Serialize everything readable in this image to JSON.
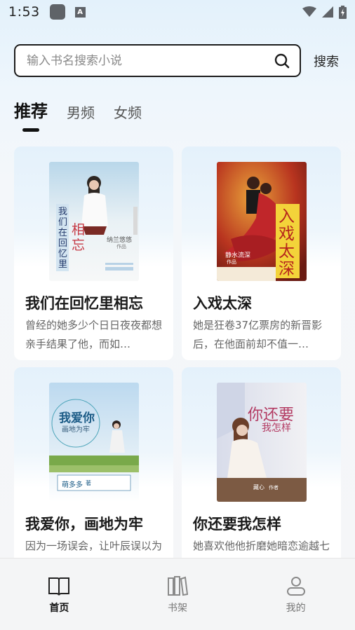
{
  "status_bar": {
    "time": "1:53",
    "icons": [
      "app-square-icon",
      "a-badge-icon",
      "wifi-icon",
      "signal-icon",
      "battery-icon"
    ]
  },
  "search": {
    "placeholder": "输入书名搜索小说",
    "button_label": "搜索"
  },
  "tabs": [
    {
      "label": "推荐",
      "active": true
    },
    {
      "label": "男频",
      "active": false
    },
    {
      "label": "女频",
      "active": false
    }
  ],
  "books": [
    {
      "title": "我们在回忆里相忘",
      "description": "曾经的她多少个日日夜夜都想亲手结果了他，而如…",
      "cover": {
        "title_a": "我们在回忆里",
        "title_b": "相忘",
        "author": "纳兰悠悠",
        "tag": "作品"
      }
    },
    {
      "title": "入戏太深",
      "description": "她是狂卷37亿票房的新晋影后，在他面前却不值一…",
      "cover": {
        "title": "入戏太深",
        "author": "静水流深",
        "tag": "作品"
      }
    },
    {
      "title": "我爱你，画地为牢",
      "description": "因为一场误会，让叶辰误以为她想谋害叶家，自此…",
      "cover": {
        "title": "我爱你",
        "subtitle": "画地为牢",
        "author": "萌多多",
        "tag": "著"
      }
    },
    {
      "title": "你还要我怎样",
      "description": "她喜欢他他折磨她暗恋逾越七年，受尽屈辱不死不…",
      "cover": {
        "title_a": "你还要",
        "title_b": "我怎样",
        "author": "藏心",
        "tag": "作者"
      }
    }
  ],
  "bottom_nav": [
    {
      "label": "首页",
      "icon": "book-open-icon",
      "active": true
    },
    {
      "label": "书架",
      "icon": "bookshelf-icon",
      "active": false
    },
    {
      "label": "我的",
      "icon": "user-icon",
      "active": false
    }
  ],
  "colors": {
    "accent": "#111111",
    "cover2_red": "#c0262a",
    "cover2_gold": "#f3d33a"
  }
}
